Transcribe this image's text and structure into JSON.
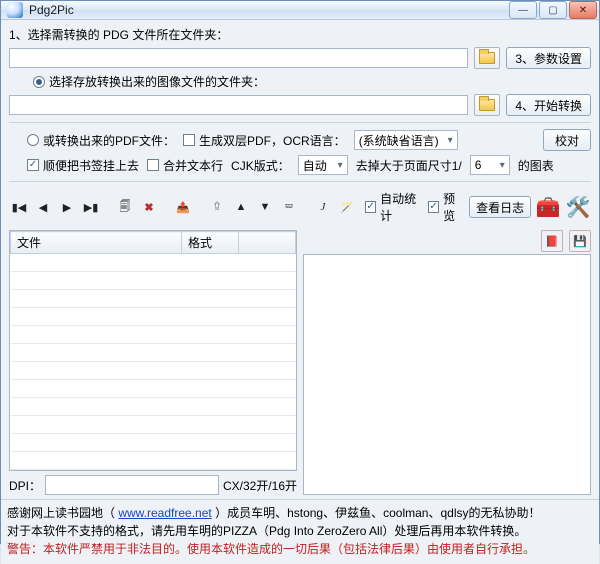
{
  "titlebar": {
    "title": "Pdg2Pic"
  },
  "row1": {
    "label": "1、选择需转换的 PDG 文件所在文件夹：",
    "button": "3、参数设置"
  },
  "row2": {
    "radio": "选择存放转换出来的图像文件的文件夹：",
    "button": "4、开始转换"
  },
  "opt_pdf": {
    "radio": "或转换出来的PDF文件：",
    "gen_dual": "生成双层PDF，OCR语言：",
    "lang": "(系统缺省语言)",
    "verify": "校对"
  },
  "opt_misc": {
    "bookmark": "顺便把书签挂上去",
    "merge": "合并文本行",
    "cjk_label": "CJK版式：",
    "cjk_value": "自动",
    "trim_prefix": "去掉大于页面尺寸1/",
    "trim_value": "6",
    "trim_suffix": "的图表"
  },
  "toolbar_right": {
    "autostat": "自动统计",
    "preview": "预览",
    "viewlog": "查看日志"
  },
  "table": {
    "col_file": "文件",
    "col_fmt": "格式"
  },
  "dpi": {
    "label": "DPI：",
    "tail": "CX/32开/16开"
  },
  "footer": {
    "line1a": "感谢网上读书园地（ ",
    "link": "www.readfree.net",
    "line1b": " ）成员车明、hstong、伊兹鱼、coolman、qdlsy的无私协助！",
    "line2": "对于本软件不支持的格式，请先用车明的PIZZA（Pdg Into ZeroZero All）处理后再用本软件转换。",
    "warn": "警告：本软件严禁用于非法目的。使用本软件造成的一切后果（包括法律后果）由使用者自行承担。"
  }
}
